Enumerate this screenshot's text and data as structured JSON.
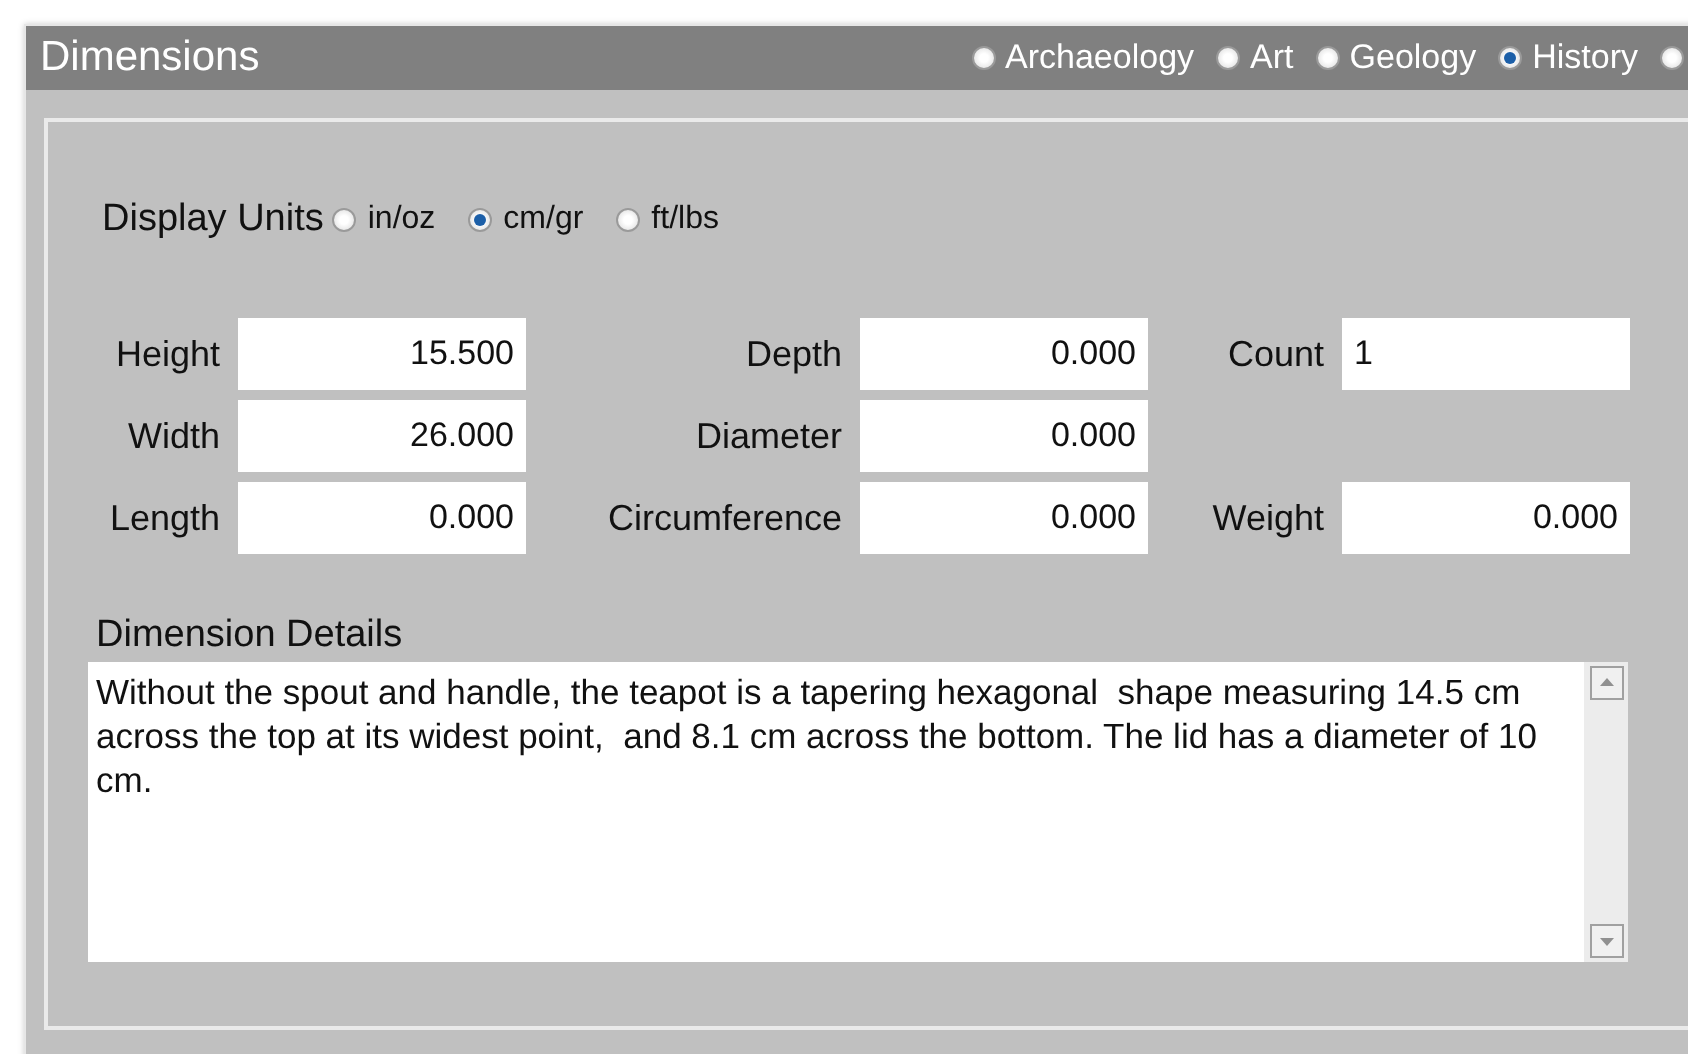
{
  "panel": {
    "title": "Dimensions"
  },
  "categories": [
    {
      "label": "Archaeology",
      "selected": false
    },
    {
      "label": "Art",
      "selected": false
    },
    {
      "label": "Geology",
      "selected": false
    },
    {
      "label": "History",
      "selected": true
    },
    {
      "selected": false
    }
  ],
  "display_units": {
    "label": "Display Units",
    "options": [
      {
        "label": "in/oz",
        "selected": false
      },
      {
        "label": "cm/gr",
        "selected": true
      },
      {
        "label": "ft/lbs",
        "selected": false
      }
    ]
  },
  "fields": [
    [
      {
        "kind": "number",
        "label": "Height",
        "value": "15.500"
      },
      {
        "kind": "number",
        "label": "Depth",
        "value": "0.000"
      },
      {
        "kind": "text",
        "label": "Count",
        "value": "1"
      }
    ],
    [
      {
        "kind": "number",
        "label": "Width",
        "value": "26.000"
      },
      {
        "kind": "number",
        "label": "Diameter",
        "value": "0.000"
      },
      {
        "kind": "blank"
      }
    ],
    [
      {
        "kind": "number",
        "label": "Length",
        "value": "0.000"
      },
      {
        "kind": "number",
        "label": "Circumference",
        "value": "0.000"
      },
      {
        "kind": "number",
        "label": "Weight",
        "value": "0.000"
      }
    ]
  ],
  "details": {
    "label": "Dimension Details",
    "text": "Without the spout and handle, the teapot is a tapering hexagonal  shape measuring 14.5 cm across the top at its widest point,  and 8.1 cm across the bottom. The lid has a diameter of 10 cm."
  }
}
